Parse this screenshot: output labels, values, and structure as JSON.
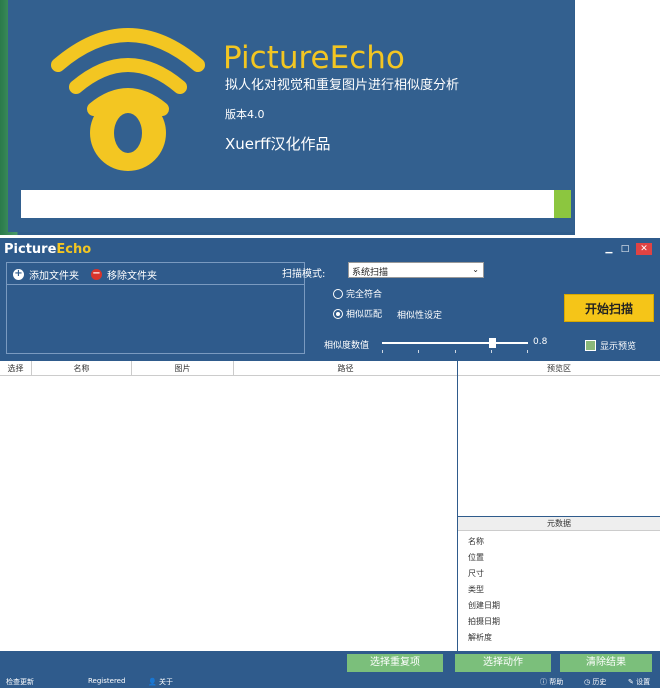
{
  "splash": {
    "title": "PictureEcho",
    "subtitle": "拟人化对视觉和重复图片进行相似度分析",
    "version": "版本4.0",
    "author": "Xuerff汉化作品",
    "progress": 0.97
  },
  "window": {
    "brand_a": "Picture",
    "brand_b": "Echo",
    "minimize": "▁",
    "maximize": "□",
    "close": "✕"
  },
  "folders": {
    "add": "添加文件夹",
    "remove": "移除文件夹"
  },
  "scan": {
    "mode_label": "扫描模式:",
    "mode_value": "系统扫描",
    "option_exact": "完全符合",
    "option_similar": "相似匹配",
    "similarity_settings": "相似性设定",
    "start": "开始扫描",
    "similarity_label": "相似度数值",
    "similarity_value": "0.8",
    "show_preview": "显示预览"
  },
  "table": {
    "columns": [
      "选择",
      "名称",
      "图片",
      "路径"
    ],
    "preview_header": "预览区"
  },
  "metadata": {
    "header": "元数据",
    "fields": [
      "名称",
      "位置",
      "尺寸",
      "类型",
      "创建日期",
      "拍摄日期",
      "解析度"
    ]
  },
  "actions": {
    "select_dupes": "选择重复项",
    "select_action": "选择动作",
    "clear": "清除结果"
  },
  "status": {
    "update": "检查更新",
    "registered": "Registered",
    "about": "关于",
    "help": "帮助",
    "history": "历史",
    "settings": "设置"
  },
  "colors": {
    "accent": "#f3c622",
    "window_bg": "#2f5b8c",
    "action_green": "#7bbf7b"
  }
}
